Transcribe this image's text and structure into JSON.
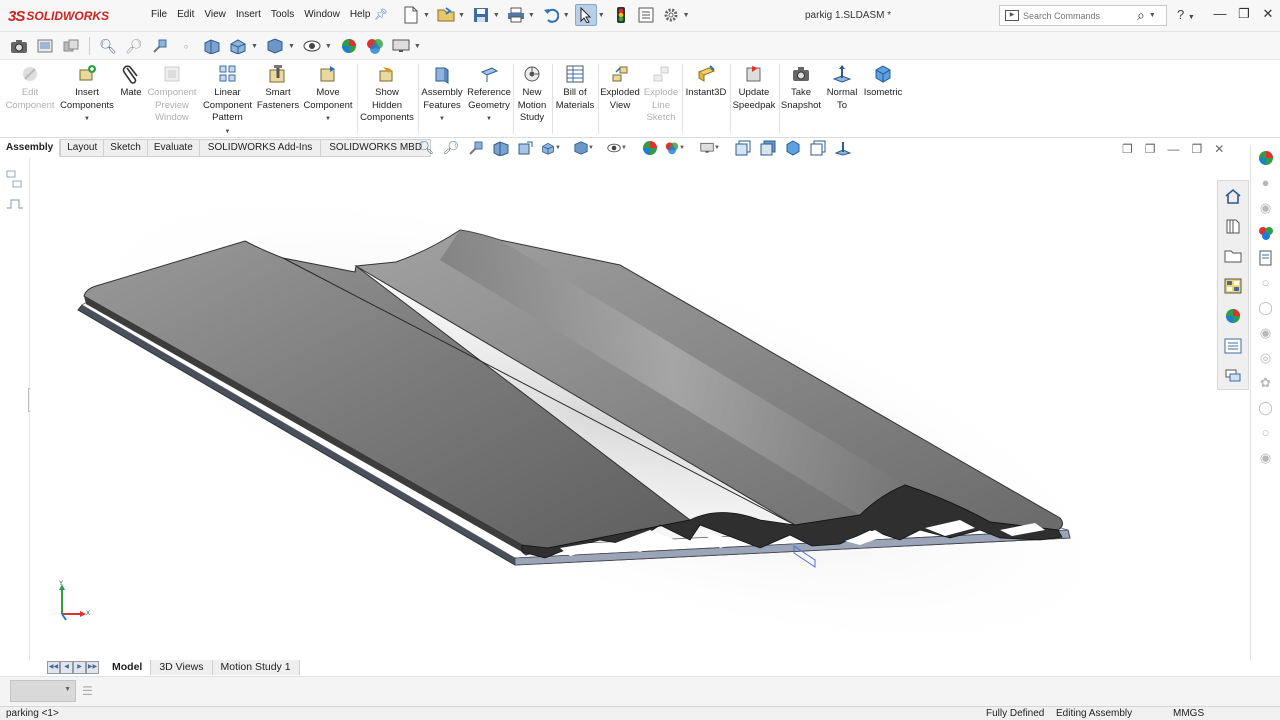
{
  "app": {
    "logo_ds": "3S",
    "logo_brand": "SOLIDWORKS",
    "document_title": "parkig 1.SLDASM *"
  },
  "menu": [
    "File",
    "Edit",
    "View",
    "Insert",
    "Tools",
    "Window",
    "Help"
  ],
  "search": {
    "placeholder": "Search Commands"
  },
  "ribbon": {
    "edit_component": "Edit\nComponent",
    "insert_components": "Insert\nComponents",
    "mate": "Mate",
    "component_preview": "Component\nPreview\nWindow",
    "linear_pattern": "Linear\nComponent\nPattern",
    "smart_fasteners": "Smart\nFasteners",
    "move_component": "Move\nComponent",
    "show_hidden": "Show\nHidden\nComponents",
    "assembly_features": "Assembly\nFeatures",
    "reference_geometry": "Reference\nGeometry",
    "new_motion_study": "New\nMotion\nStudy",
    "bill_of_materials": "Bill of\nMaterials",
    "exploded_view": "Exploded\nView",
    "explode_line_sketch": "Explode\nLine\nSketch",
    "instant3d": "Instant3D",
    "update_speedpak": "Update\nSpeedpak",
    "take_snapshot": "Take\nSnapshot",
    "normal_to": "Normal\nTo",
    "isometric": "Isometric"
  },
  "tabs": [
    "Assembly",
    "Layout",
    "Sketch",
    "Evaluate",
    "SOLIDWORKS Add-Ins",
    "SOLIDWORKS MBD"
  ],
  "triad": {
    "y": "Y",
    "x": "X"
  },
  "bottom_tabs": [
    "Model",
    "3D Views",
    "Motion Study 1"
  ],
  "status": {
    "left": "parking <1>",
    "defined": "Fully Defined",
    "mode": "Editing Assembly",
    "units": "MMGS"
  },
  "colors": {
    "brand_red": "#d0231f",
    "accent_blue": "#3b6ea5",
    "model_gray": "#8c8c8c"
  }
}
